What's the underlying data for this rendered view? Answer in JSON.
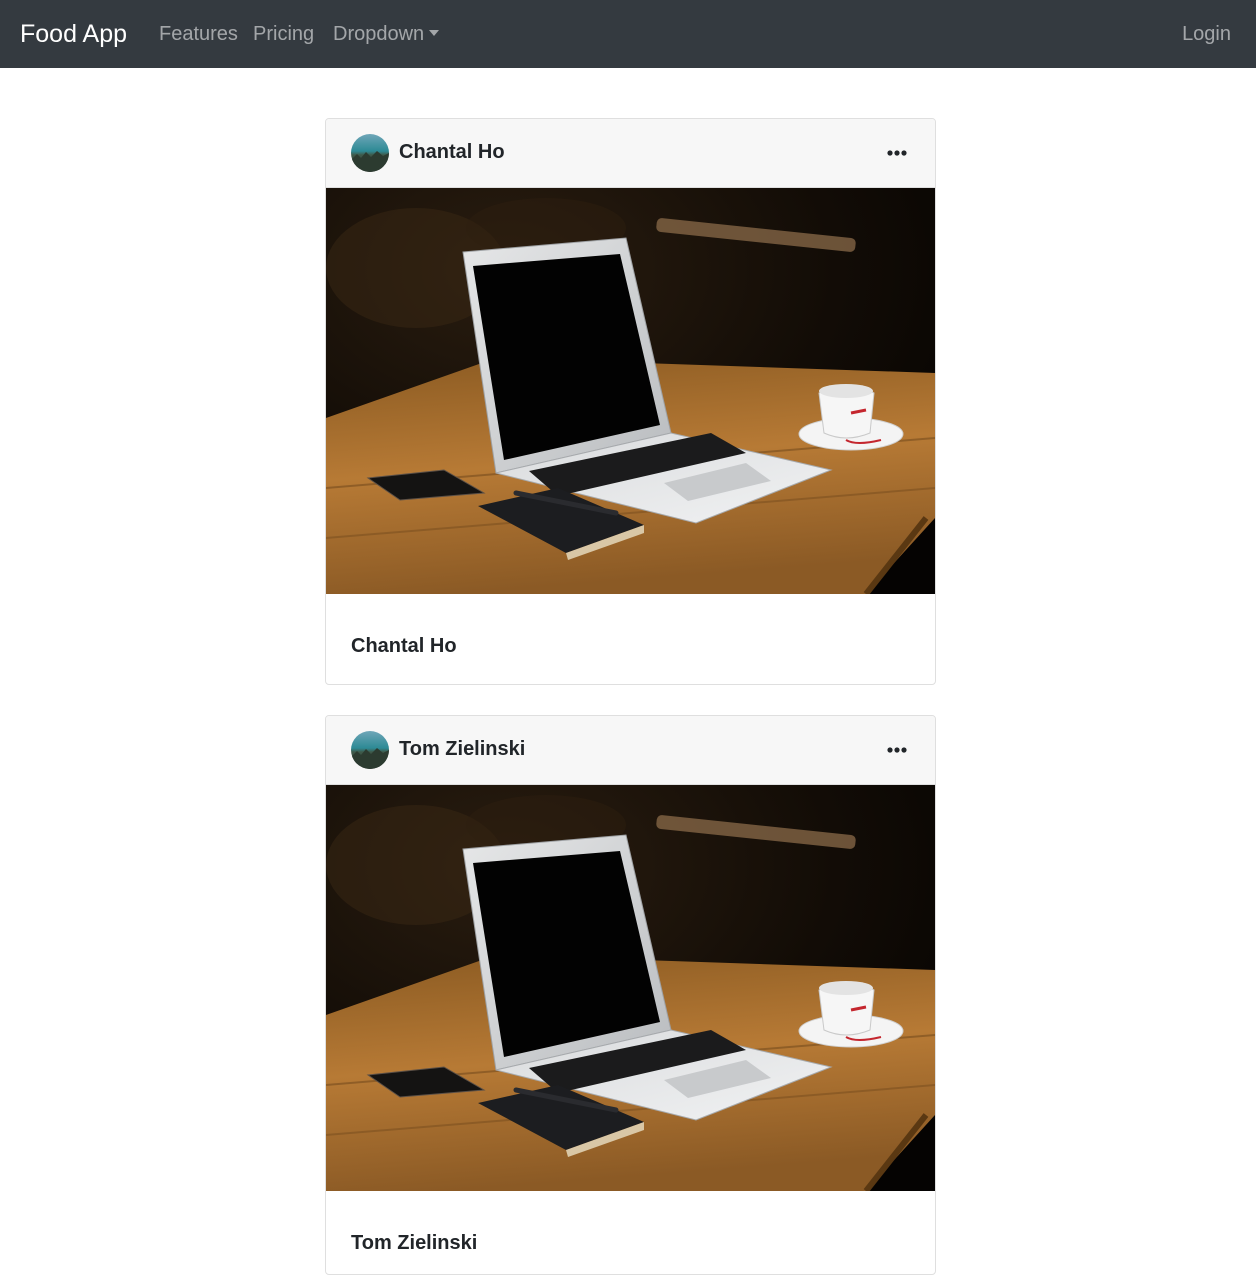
{
  "navbar": {
    "brand": "Food App",
    "links": [
      "Features",
      "Pricing",
      "Dropdown"
    ],
    "login": "Login",
    "background_color": "#343a40"
  },
  "posts": [
    {
      "author": "Chantal Ho",
      "caption": "Chantal Ho",
      "menu_icon": "more-horizontal-icon",
      "image": "laptop on wooden table with phone, notebook and coffee cup"
    },
    {
      "author": "Tom Zielinski",
      "caption": "Tom Zielinski",
      "menu_icon": "more-horizontal-icon",
      "image": "laptop on wooden table with phone, notebook and coffee cup"
    }
  ]
}
